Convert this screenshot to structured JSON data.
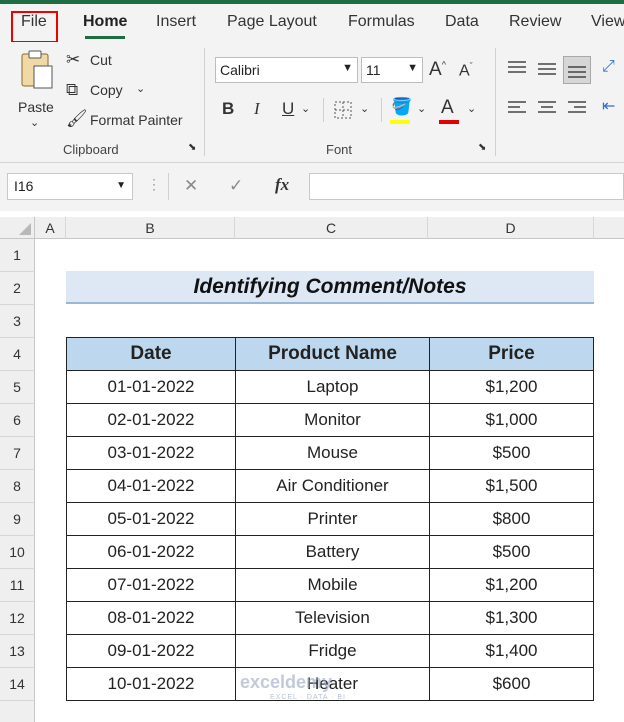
{
  "ribbon_tabs": [
    "File",
    "Home",
    "Insert",
    "Page Layout",
    "Formulas",
    "Data",
    "Review",
    "View"
  ],
  "clipboard": {
    "paste": "Paste",
    "cut": "Cut",
    "copy": "Copy",
    "format_painter": "Format Painter",
    "group_label": "Clipboard"
  },
  "font": {
    "family": "Calibri",
    "size": "11",
    "group_label": "Font",
    "bold": "B",
    "italic": "I",
    "underline": "U",
    "font_color_letter": "A",
    "highlight_color": "#ffff00",
    "font_color": "#e00000"
  },
  "formula_bar": {
    "name_box": "I16",
    "fx": "fx",
    "cancel": "✕",
    "enter": "✓",
    "formula": ""
  },
  "columns": [
    "A",
    "B",
    "C",
    "D"
  ],
  "rows": [
    "1",
    "2",
    "3",
    "4",
    "5",
    "6",
    "7",
    "8",
    "9",
    "10",
    "11",
    "12",
    "13",
    "14"
  ],
  "sheet": {
    "title": "Identifying Comment/Notes",
    "headers": [
      "Date",
      "Product Name",
      "Price"
    ],
    "records": [
      [
        "01-01-2022",
        "Laptop",
        "$1,200"
      ],
      [
        "02-01-2022",
        "Monitor",
        "$1,000"
      ],
      [
        "03-01-2022",
        "Mouse",
        "$500"
      ],
      [
        "04-01-2022",
        "Air Conditioner",
        "$1,500"
      ],
      [
        "05-01-2022",
        "Printer",
        "$800"
      ],
      [
        "06-01-2022",
        "Battery",
        "$500"
      ],
      [
        "07-01-2022",
        "Mobile",
        "$1,200"
      ],
      [
        "08-01-2022",
        "Television",
        "$1,300"
      ],
      [
        "09-01-2022",
        "Fridge",
        "$1,400"
      ],
      [
        "10-01-2022",
        "Heater",
        "$600"
      ]
    ]
  },
  "watermark": {
    "brand": "exceldemy",
    "tagline": "EXCEL · DATA · BI"
  }
}
